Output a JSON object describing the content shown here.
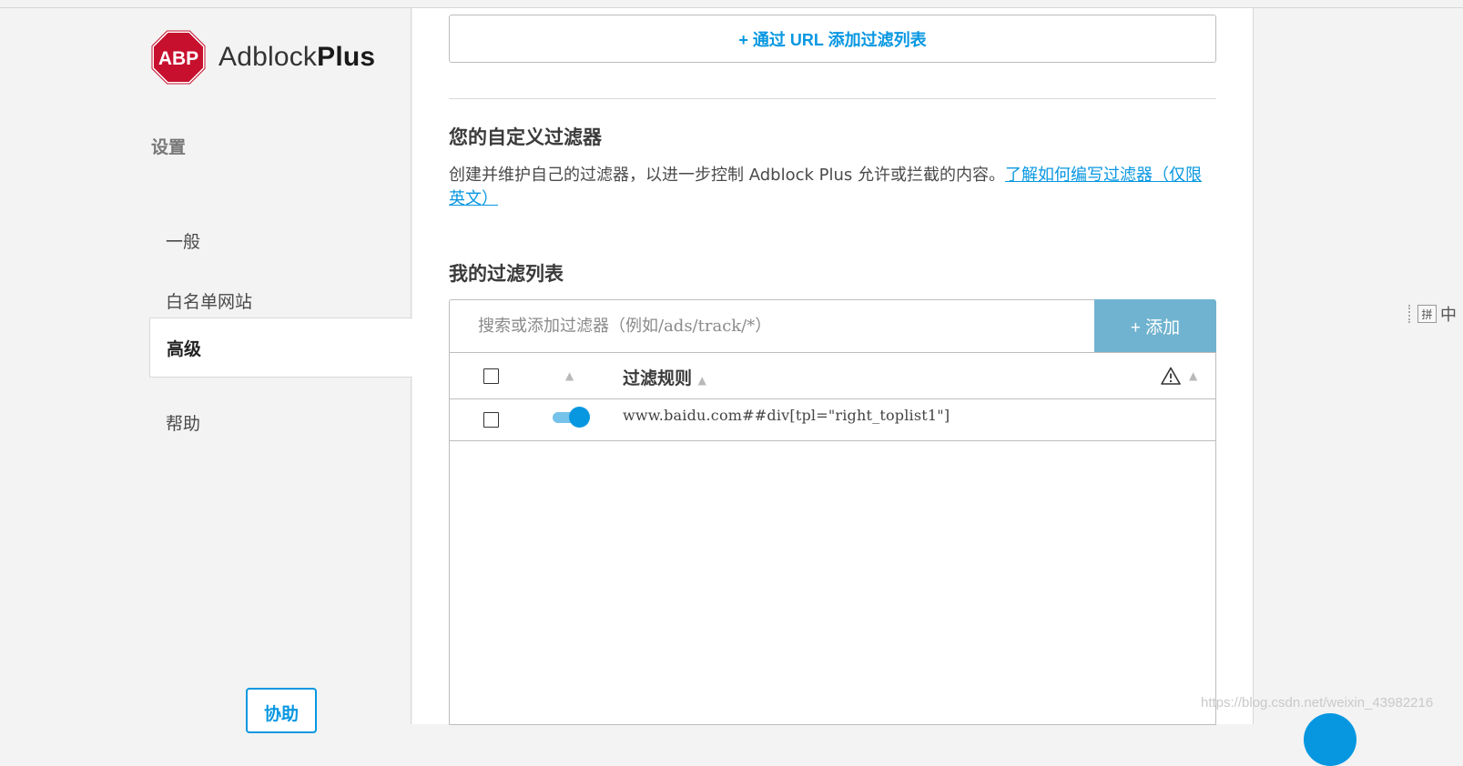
{
  "app": {
    "brand_light": "Adblock",
    "brand_bold": "Plus",
    "logo_text": "ABP",
    "accent_color": "#0797e1",
    "logo_color": "#c7102e"
  },
  "sidebar": {
    "section_title": "设置",
    "items": [
      {
        "label": "一般",
        "active": false
      },
      {
        "label": "白名单网站",
        "active": false
      },
      {
        "label": "高级",
        "active": true
      },
      {
        "label": "帮助",
        "active": false
      }
    ],
    "help_button": "协助"
  },
  "main": {
    "add_url_button": "+ 通过 URL 添加过滤列表",
    "custom_filters": {
      "heading": "您的自定义过滤器",
      "description": "创建并维护自己的过滤器，以进一步控制 Adblock Plus 允许或拦截的内容。",
      "link_text": "了解如何编写过滤器（仅限英文）"
    },
    "my_filter_list": {
      "heading": "我的过滤列表",
      "search_placeholder": "搜索或添加过滤器（例如/ads/track/*）",
      "add_button": "+ 添加",
      "columns": {
        "rule_header": "过滤规则",
        "warning_icon": "warning-icon"
      },
      "rows": [
        {
          "enabled": true,
          "checked": false,
          "rule": "www.baidu.com##div[tpl=\"right_toplist1\"]"
        }
      ]
    }
  },
  "overlay": {
    "ime_box": "拼",
    "ime_char": "中",
    "watermark": "https://blog.csdn.net/weixin_43982216"
  }
}
